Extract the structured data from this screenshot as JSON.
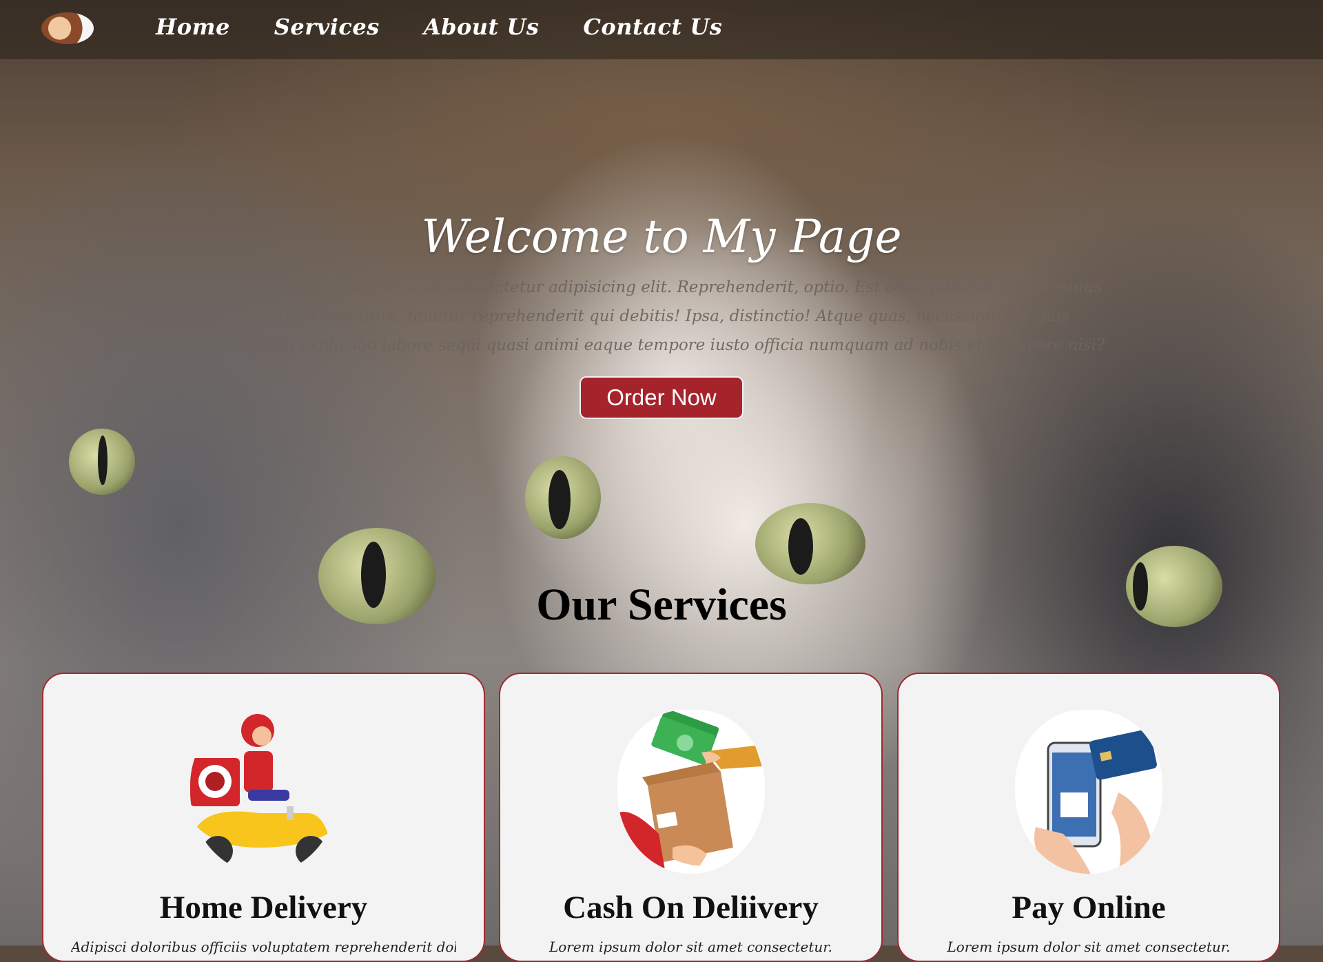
{
  "nav": {
    "links": [
      "Home",
      "Services",
      "About Us",
      "Contact Us"
    ]
  },
  "hero": {
    "title": "Welcome to My Page",
    "text": "Lorem ipsum dolor sit amet consectetur adipisicing elit. Reprehenderit, optio. Est odio quibusdam quo minus adipisci inventore, tenetur reprehenderit qui debitis! Ipsa, distinctio! Atque quas, necessitatibus quis obcaecati explicabo labore sequi quasi animi eaque tempore iusto officia numquam ad nobis et ab facere nisi?",
    "order_button": "Order Now"
  },
  "services": {
    "title": "Our Services",
    "cards": [
      {
        "title": "Home Delivery",
        "desc": "Adipisci doloribus officiis voluptatem reprehenderit dolore."
      },
      {
        "title": "Cash On Deliivery",
        "desc": "Lorem ipsum dolor sit amet consectetur."
      },
      {
        "title": "Pay Online",
        "desc": "Lorem ipsum dolor sit amet consectetur."
      }
    ]
  },
  "colors": {
    "accent": "#a5232b",
    "card_bg": "#f3f3f3",
    "card_border": "#9e2a31"
  },
  "icons": [
    "logo-avatar",
    "delivery-scooter-icon",
    "cash-handover-icon",
    "pay-online-icon"
  ]
}
